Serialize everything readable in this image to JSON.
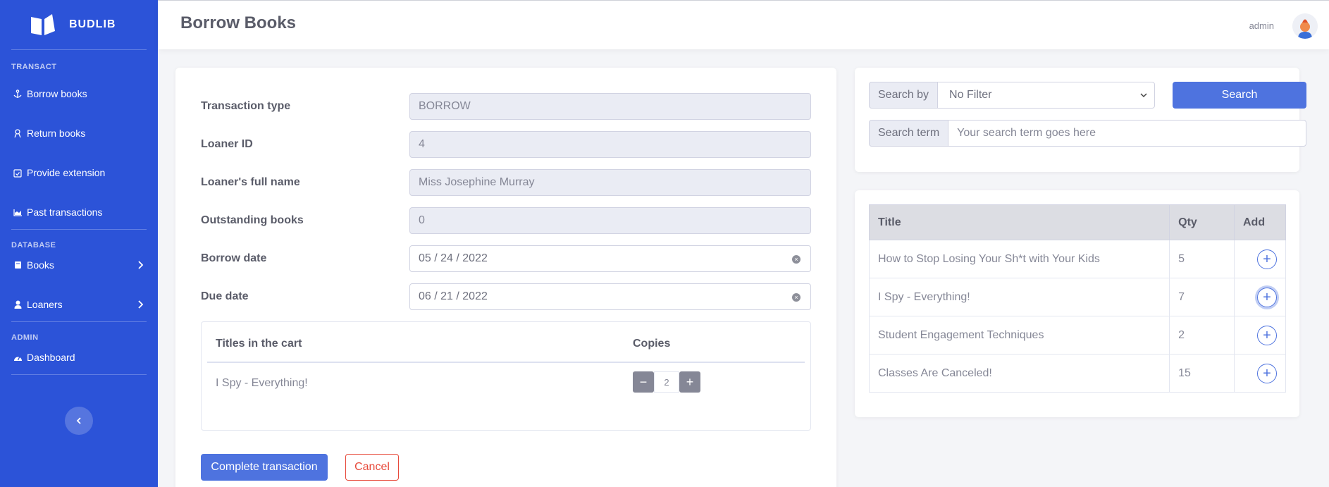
{
  "brand": {
    "name": "BUDLIB"
  },
  "sidebar": {
    "headings": {
      "transact": "TRANSACT",
      "database": "DATABASE",
      "admin": "ADMIN"
    },
    "transact_items": [
      {
        "label": "Borrow books",
        "icon": "anchor-icon"
      },
      {
        "label": "Return books",
        "icon": "user-return-icon"
      },
      {
        "label": "Provide extension",
        "icon": "calendar-check-icon"
      },
      {
        "label": "Past transactions",
        "icon": "chart-area-icon"
      }
    ],
    "database_items": [
      {
        "label": "Books",
        "icon": "book-icon"
      },
      {
        "label": "Loaners",
        "icon": "user-icon"
      }
    ],
    "admin_items": [
      {
        "label": "Dashboard",
        "icon": "tachometer-icon"
      }
    ]
  },
  "topbar": {
    "title": "Borrow Books",
    "user": "admin"
  },
  "form": {
    "transaction_type": {
      "label": "Transaction type",
      "value": "BORROW"
    },
    "loaner_id": {
      "label": "Loaner ID",
      "value": "4"
    },
    "loaner_name": {
      "label": "Loaner's full name",
      "value": "Miss Josephine Murray"
    },
    "outstanding": {
      "label": "Outstanding books",
      "value": "0"
    },
    "borrow_date": {
      "label": "Borrow date",
      "value": "05 / 24 / 2022"
    },
    "due_date": {
      "label": "Due date",
      "value": "06 / 21 / 2022"
    }
  },
  "cart": {
    "col_title": "Titles in the cart",
    "col_copies": "Copies",
    "items": [
      {
        "title": "I Spy - Everything!",
        "copies": "2"
      }
    ]
  },
  "actions": {
    "complete": "Complete transaction",
    "cancel": "Cancel"
  },
  "search": {
    "by_label": "Search by",
    "by_value": "No Filter",
    "term_label": "Search term",
    "term_placeholder": "Your search term goes here",
    "button": "Search"
  },
  "results": {
    "headers": {
      "title": "Title",
      "qty": "Qty",
      "add": "Add"
    },
    "rows": [
      {
        "title": "How to Stop Losing Your Sh*t with Your Kids",
        "qty": "5"
      },
      {
        "title": "I Spy - Everything!",
        "qty": "7"
      },
      {
        "title": "Student Engagement Techniques",
        "qty": "2"
      },
      {
        "title": "Classes Are Canceled!",
        "qty": "15"
      }
    ]
  },
  "colors": {
    "sidebar": "#2c53d8",
    "primary": "#4e73df",
    "danger": "#e74a3b"
  }
}
